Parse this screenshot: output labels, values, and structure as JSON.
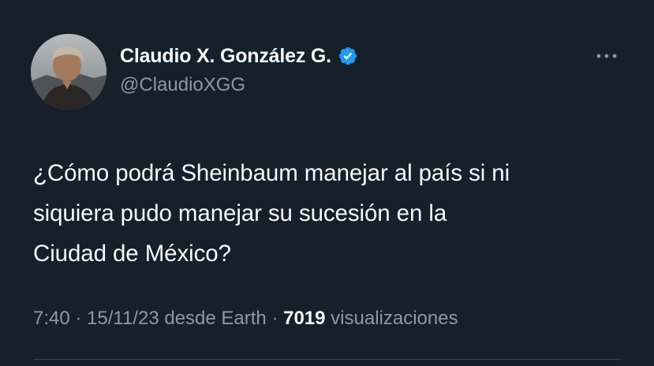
{
  "author": {
    "display_name": "Claudio X. González G.",
    "handle": "@ClaudioXGG",
    "verified": true,
    "avatar_icon": "profile-photo"
  },
  "tweet": {
    "text_lines": [
      "¿Cómo podrá Sheinbaum manejar al país si ni",
      "siquiera pudo manejar su sucesión en la",
      "Ciudad de México?"
    ]
  },
  "meta": {
    "time": "7:40",
    "separator": " · ",
    "date": "15/11/23",
    "source": "desde Earth",
    "view_count": "7019",
    "view_label": "visualizaciones"
  },
  "colors": {
    "background": "#15202b",
    "primary_text": "#f7f9f9",
    "secondary_text": "#8b98a5",
    "verified_badge": "#1d9bf0"
  }
}
